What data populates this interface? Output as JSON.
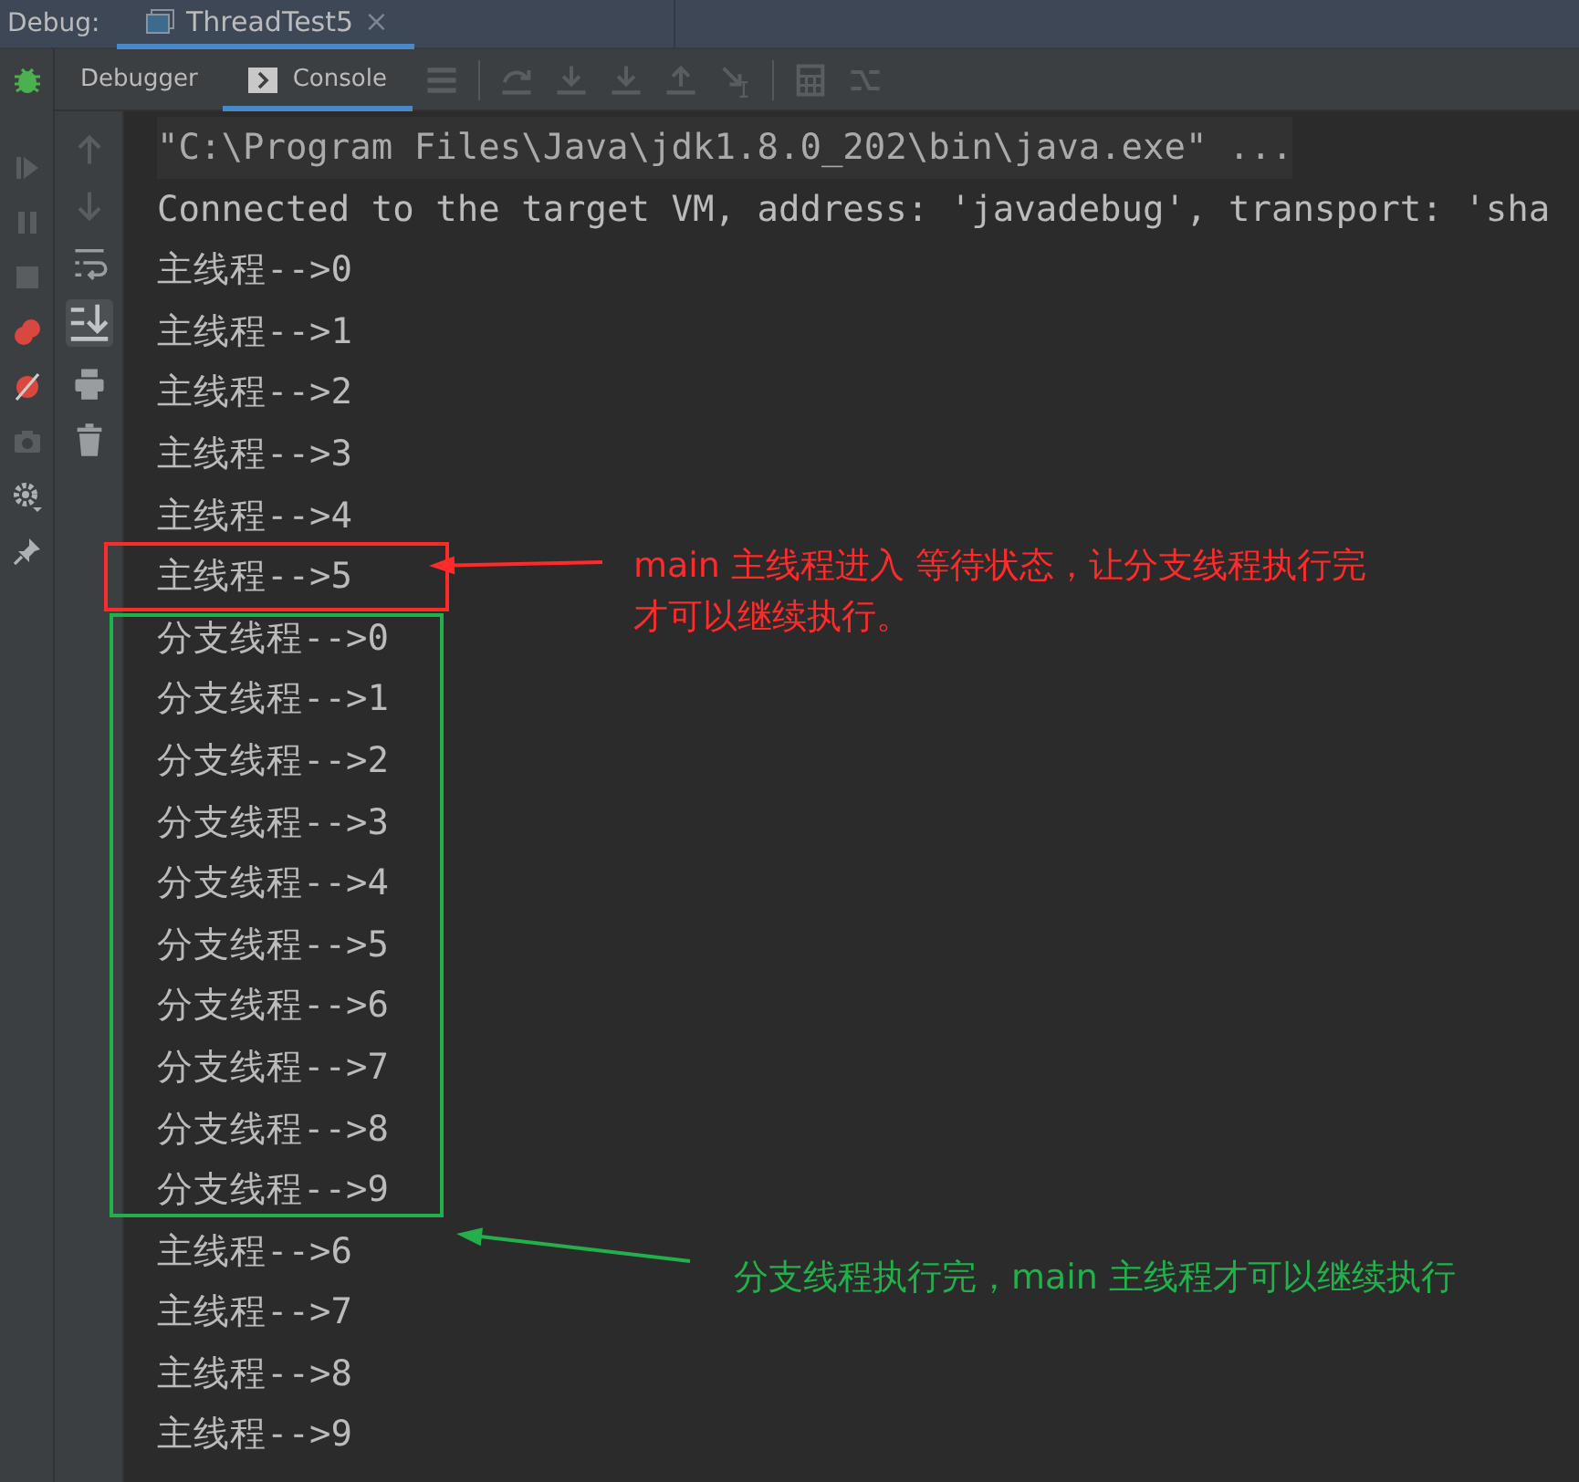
{
  "top_bar": {
    "label": "Debug:",
    "tab": {
      "title": "ThreadTest5",
      "selected": true,
      "close": "×"
    }
  },
  "toolbar": {
    "tabs": [
      {
        "label": "Debugger",
        "selected": false
      },
      {
        "label": "Console",
        "selected": true
      }
    ]
  },
  "console": {
    "lines": [
      {
        "kind": "command",
        "text": "\"C:\\Program Files\\Java\\jdk1.8.0_202\\bin\\java.exe\" ..."
      },
      {
        "kind": "output",
        "text": "Connected to the target VM, address: 'javadebug', transport: 'sha"
      },
      {
        "kind": "output",
        "text": "主线程-->0"
      },
      {
        "kind": "output",
        "text": "主线程-->1"
      },
      {
        "kind": "output",
        "text": "主线程-->2"
      },
      {
        "kind": "output",
        "text": "主线程-->3"
      },
      {
        "kind": "output",
        "text": "主线程-->4"
      },
      {
        "kind": "output",
        "text": "主线程-->5"
      },
      {
        "kind": "output",
        "text": "分支线程-->0"
      },
      {
        "kind": "output",
        "text": "分支线程-->1"
      },
      {
        "kind": "output",
        "text": "分支线程-->2"
      },
      {
        "kind": "output",
        "text": "分支线程-->3"
      },
      {
        "kind": "output",
        "text": "分支线程-->4"
      },
      {
        "kind": "output",
        "text": "分支线程-->5"
      },
      {
        "kind": "output",
        "text": "分支线程-->6"
      },
      {
        "kind": "output",
        "text": "分支线程-->7"
      },
      {
        "kind": "output",
        "text": "分支线程-->8"
      },
      {
        "kind": "output",
        "text": "分支线程-->9"
      },
      {
        "kind": "output",
        "text": "主线程-->6"
      },
      {
        "kind": "output",
        "text": "主线程-->7"
      },
      {
        "kind": "output",
        "text": "主线程-->8"
      },
      {
        "kind": "output",
        "text": "主线程-->9"
      }
    ]
  },
  "annotations": [
    {
      "color": "#ff2a2a",
      "lines": [
        "main 主线程进入 等待状态，让分支线程执行完",
        "才可以继续执行。"
      ]
    },
    {
      "color": "#22b04a",
      "lines": [
        "分支线程执行完，main 主线程才可以继续执行"
      ]
    }
  ]
}
